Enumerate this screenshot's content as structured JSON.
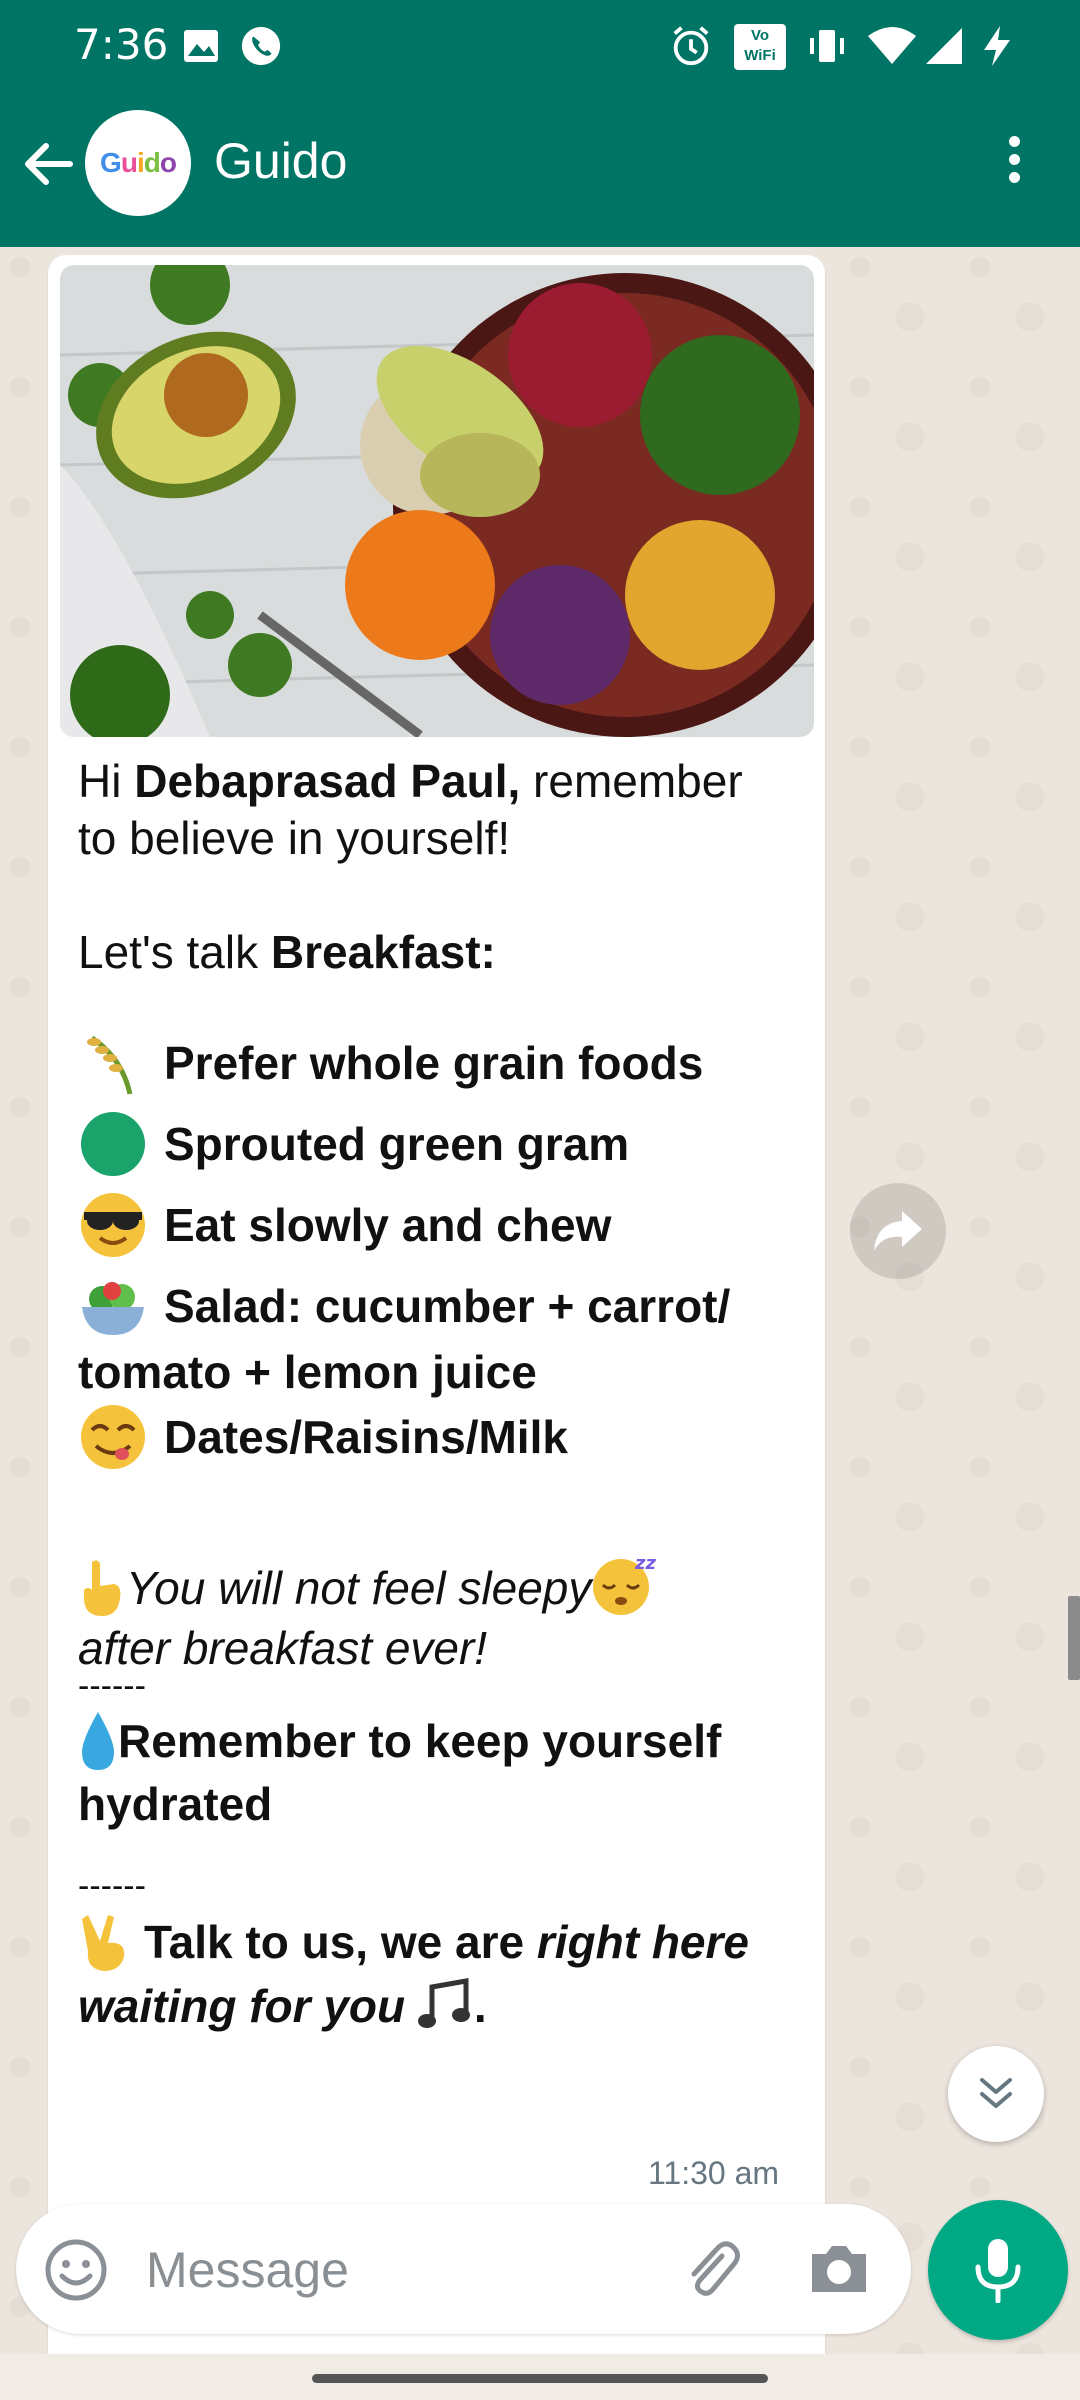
{
  "status_bar": {
    "time": "7:36",
    "icons": [
      "gallery-icon",
      "whatsapp-icon",
      "alarm-icon",
      "vowifi-icon",
      "vibrate-icon",
      "wifi-icon",
      "signal-icon",
      "charging-icon"
    ],
    "vowifi_label": "Vo WiFi"
  },
  "header": {
    "contact_name": "Guido",
    "avatar_letters": [
      "G",
      "u",
      "i",
      "d",
      "o"
    ],
    "avatar_colors": [
      "#3f8ee9",
      "#e94f9b",
      "#f5a623",
      "#7bc043",
      "#8e44ad"
    ],
    "accent_color": "#007565"
  },
  "message": {
    "greeting_prefix": "Hi ",
    "name": "Debaprasad Paul,",
    "greeting_suffix": " remember",
    "greeting_line2": "to believe in yourself!",
    "talk_prefix": "Let's talk ",
    "meal": "Breakfast:",
    "bullets": [
      {
        "icon": "rice-ear-icon",
        "text": "Prefer whole grain foods"
      },
      {
        "icon": "green-circle-icon",
        "text": "Sprouted green gram"
      },
      {
        "icon": "sunglasses-face-icon",
        "text": "Eat slowly and chew"
      },
      {
        "icon": "salad-bowl-icon",
        "text": "Salad: cucumber + carrot/"
      },
      {
        "icon": "",
        "text": "tomato + lemon juice"
      },
      {
        "icon": "yummy-face-icon",
        "text": "Dates/Raisins/Milk"
      }
    ],
    "sleepy_line1": "You will not feel sleepy",
    "sleepy_line2": "after breakfast ever!",
    "divider": "------",
    "hydrate_line1": "Remember to keep yourself",
    "hydrate_line2": "hydrated",
    "talk_line1_bold": "Talk to us, we are ",
    "talk_line1_bold_italic": "right here",
    "talk_line2_bold_italic": "waiting for you",
    "talk_line2_end": ".",
    "timestamp": "11:30 am"
  },
  "composer": {
    "placeholder": "Message"
  },
  "colors": {
    "bubble": "#ffffff",
    "mic_button": "#00a884",
    "wallpaper": "#ece5dd"
  }
}
